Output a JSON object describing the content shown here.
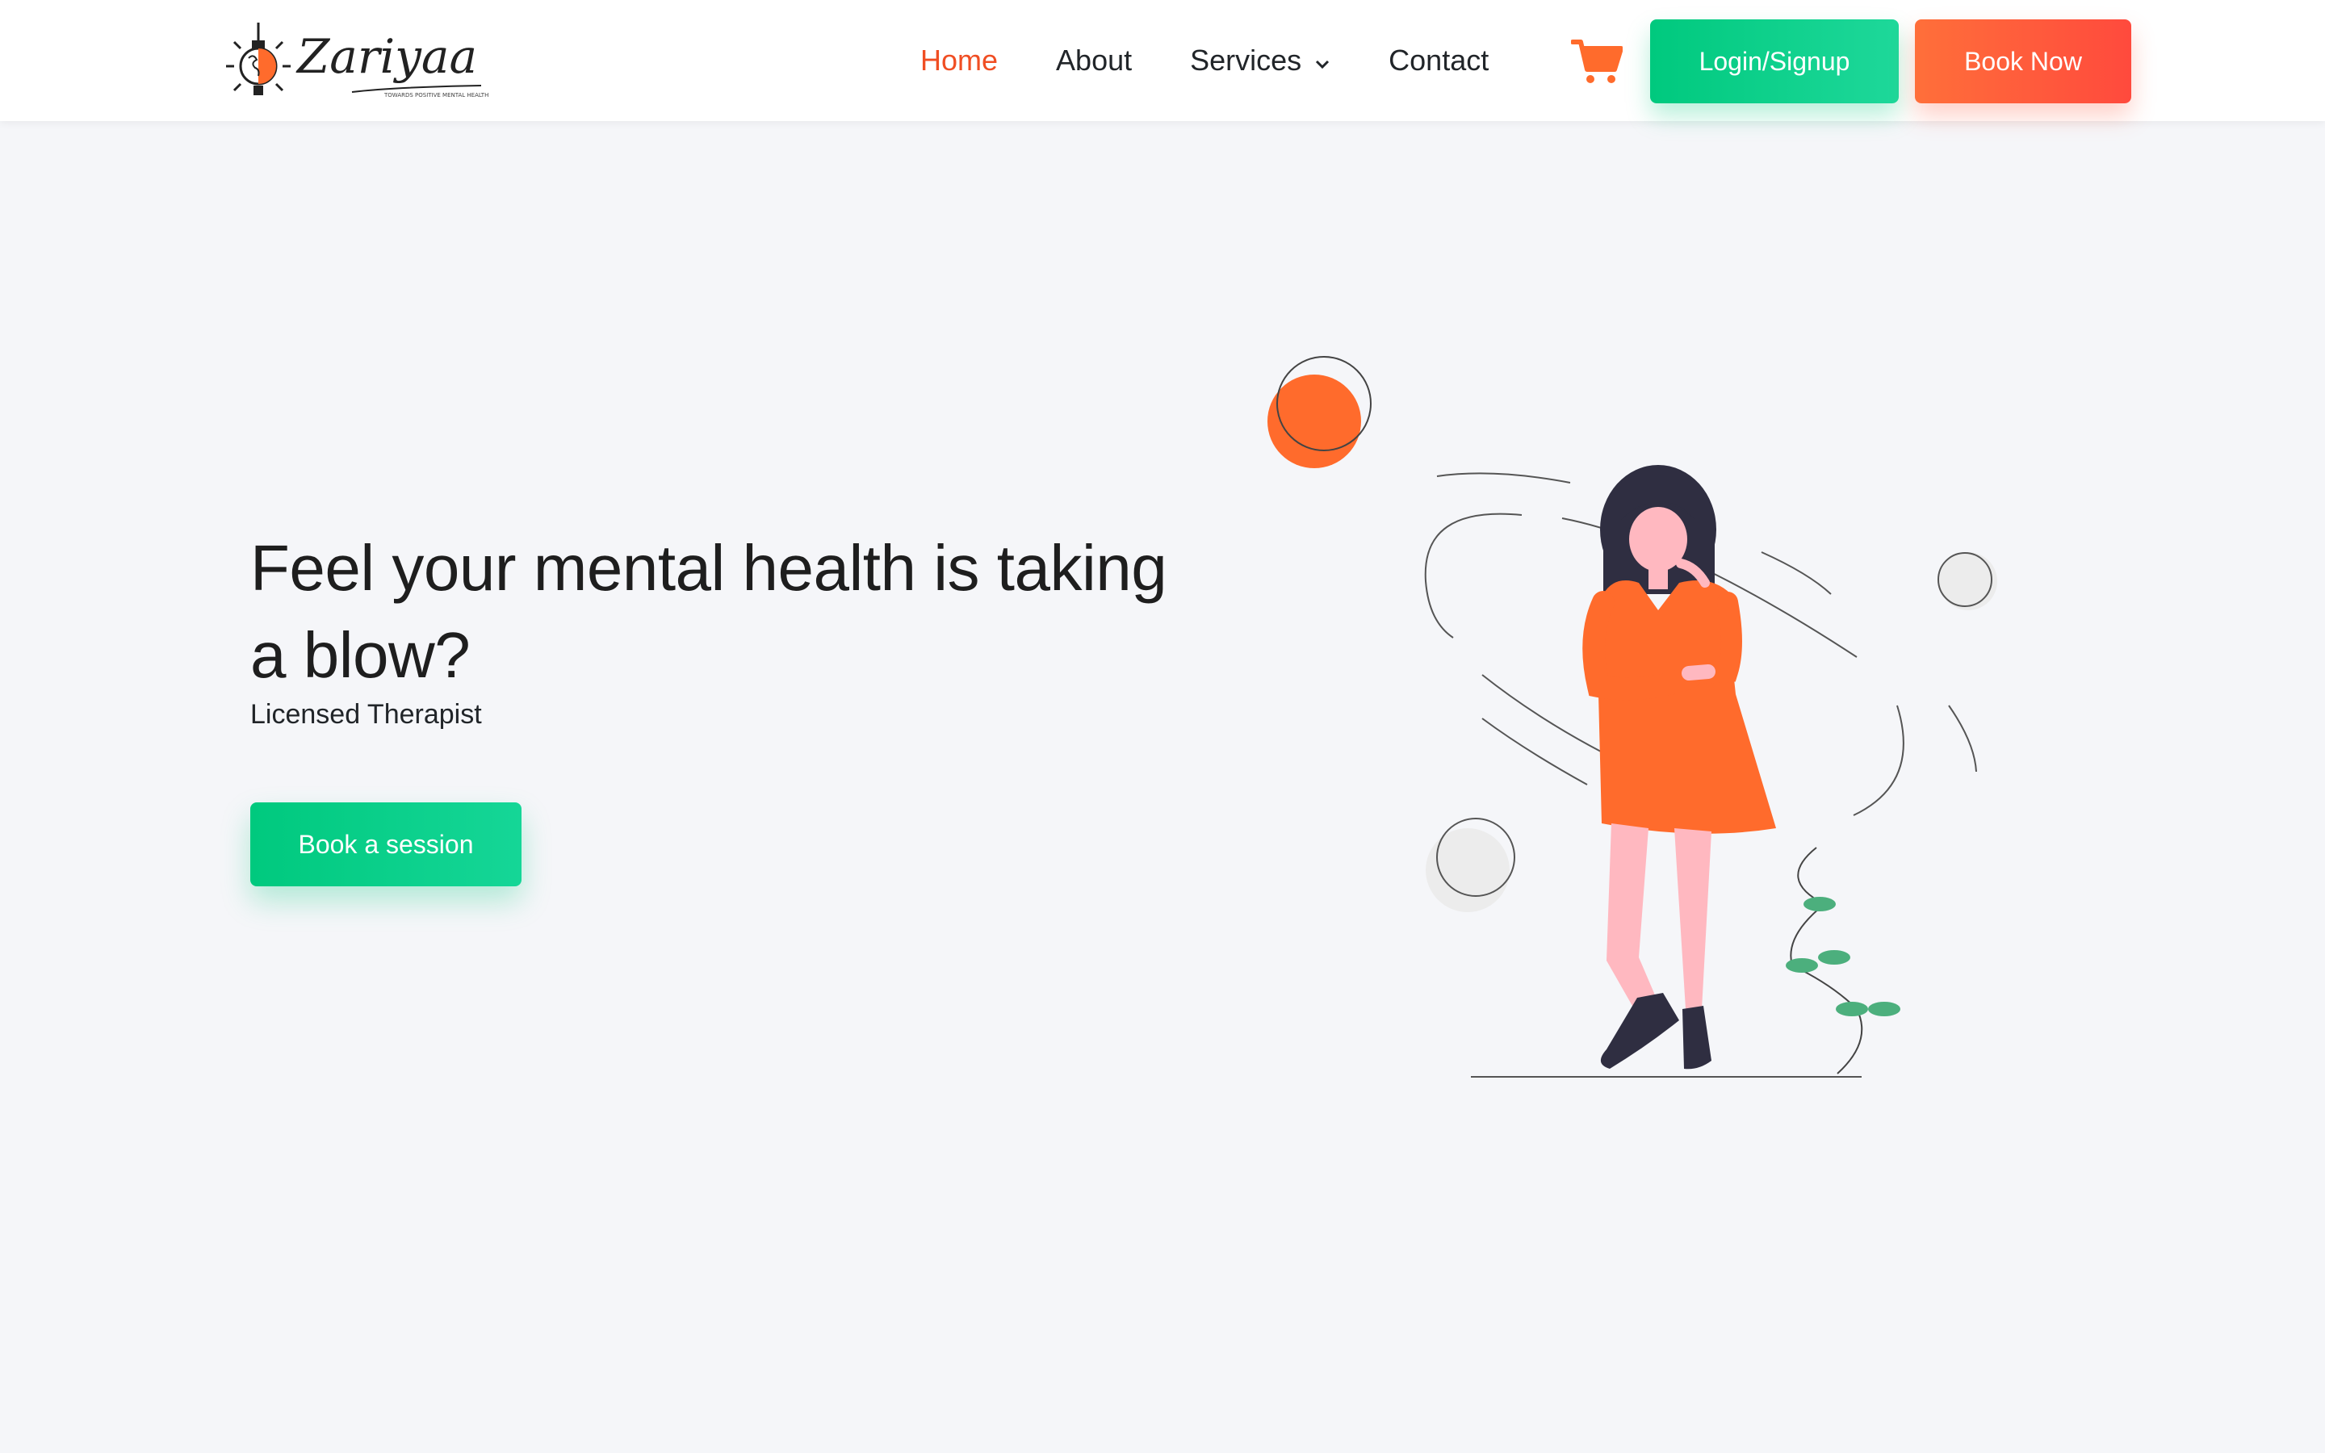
{
  "brand": {
    "name": "Zariyaa",
    "tagline": "TOWARDS POSITIVE MENTAL HEALTH",
    "logo_icon": "brain-lightbulb-icon"
  },
  "nav": {
    "items": [
      {
        "label": "Home",
        "active": true
      },
      {
        "label": "About",
        "active": false
      },
      {
        "label": "Services",
        "active": false,
        "has_dropdown": true
      },
      {
        "label": "Contact",
        "active": false
      }
    ],
    "cart_icon": "cart-icon",
    "login_label": "Login/Signup",
    "book_label": "Book Now"
  },
  "hero": {
    "title": "Feel your mental health is taking a blow?",
    "subtitle": "Licensed Therapist",
    "cta_label": "Book a session",
    "illustration": "woman-thinking-illustration"
  },
  "colors": {
    "accent_orange": "#ff6b2c",
    "accent_green": "#00c97e",
    "active_link": "#f04e23",
    "background": "#f5f6f9"
  }
}
